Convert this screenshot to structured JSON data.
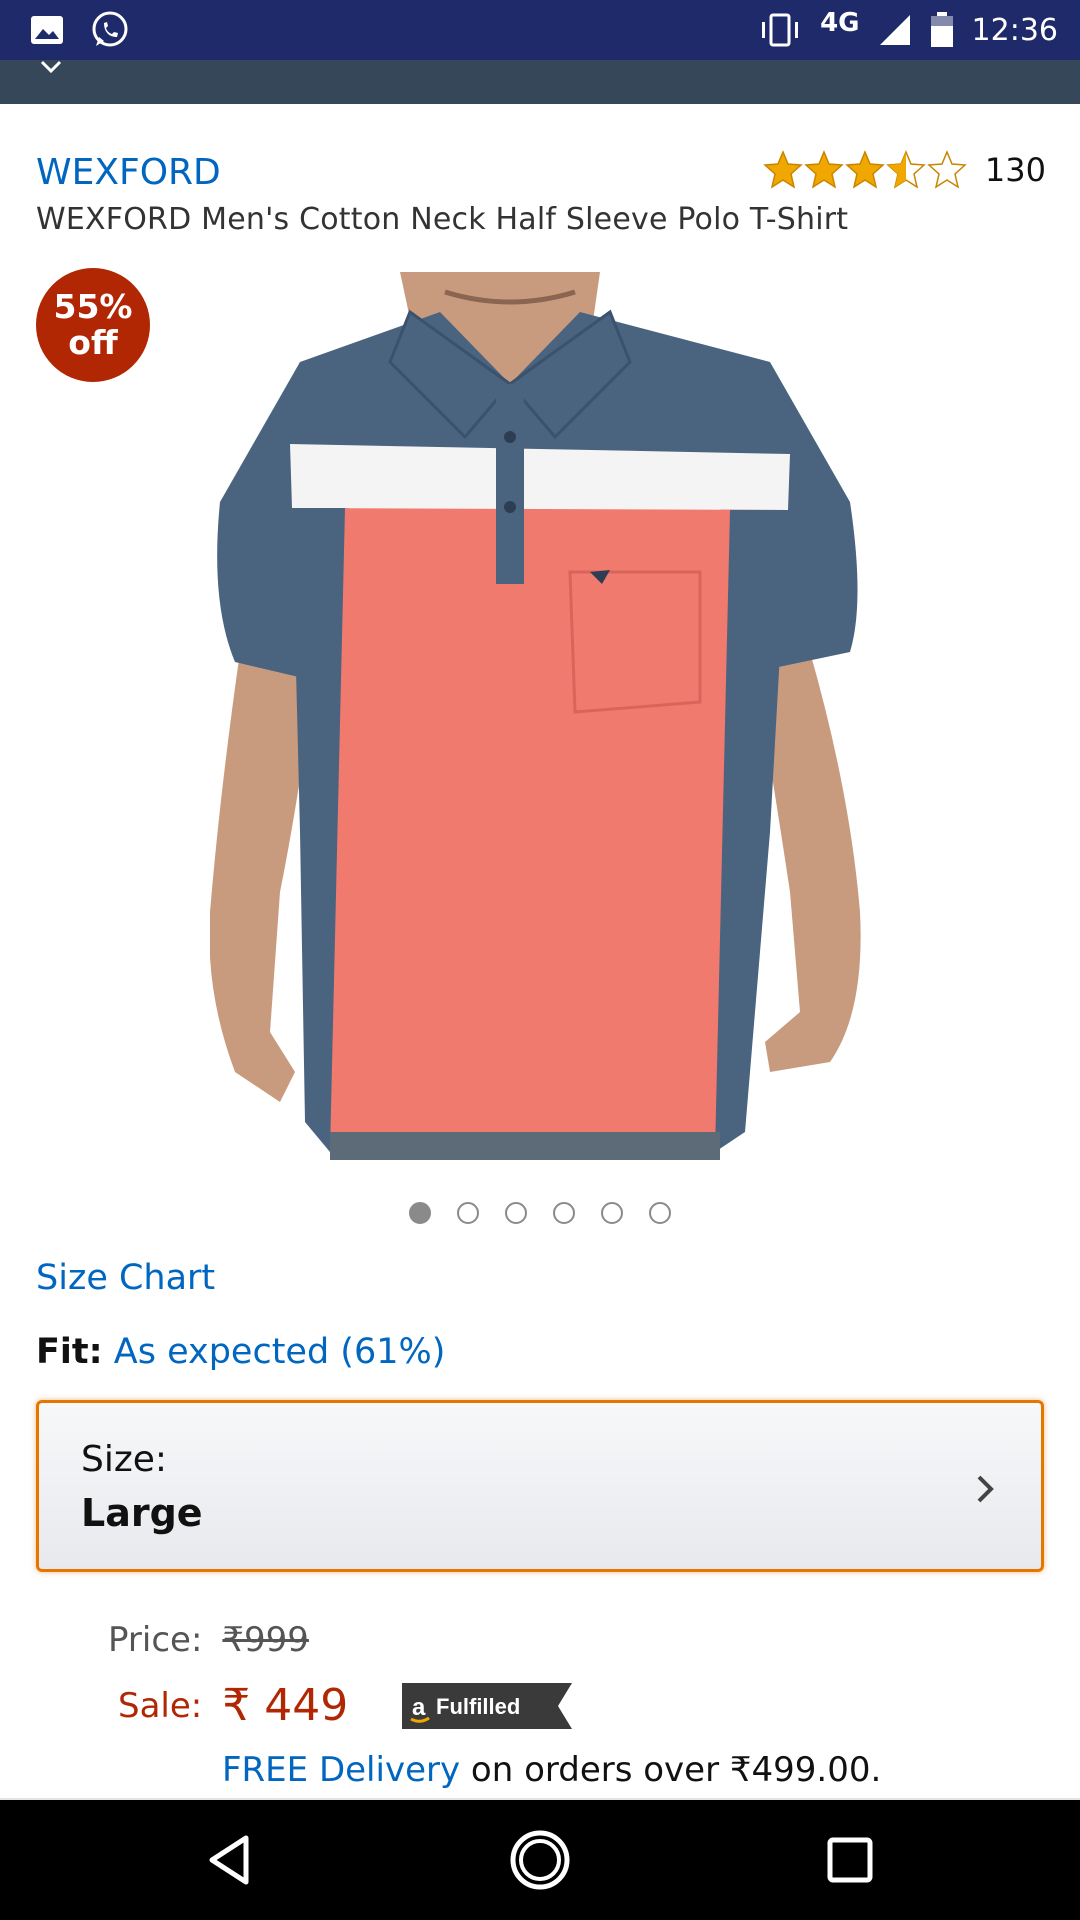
{
  "status_bar": {
    "network": "4G",
    "time": "12:36",
    "icons": [
      "image-icon",
      "whatsapp-icon",
      "vibrate-icon",
      "signal-icon",
      "battery-icon"
    ]
  },
  "product": {
    "brand": "WEXFORD",
    "title": "WEXFORD Men's Cotton Neck Half Sleeve Polo T-Shirt",
    "rating_stars": 3.5,
    "rating_max": 5,
    "rating_count": "130",
    "discount_line1": "55%",
    "discount_line2": "off",
    "image_count": 6,
    "active_image": 0
  },
  "size_chart": {
    "label": "Size Chart"
  },
  "fit": {
    "label": "Fit:",
    "value": "As expected (61%)"
  },
  "size_selector": {
    "label": "Size:",
    "value": "Large"
  },
  "pricing": {
    "price_label": "Price:",
    "mrp": "₹999",
    "sale_label": "Sale:",
    "sale_price": "₹ 449",
    "fulfilled_badge": "Fulfilled"
  },
  "delivery": {
    "free_text": "FREE Delivery",
    "rest_text": "on orders over ₹499.00."
  },
  "colors": {
    "status_bar": "#1f2a6b",
    "link": "#0066c0",
    "sale": "#b12704",
    "accent_border": "#e77600",
    "star": "#f0a800"
  }
}
